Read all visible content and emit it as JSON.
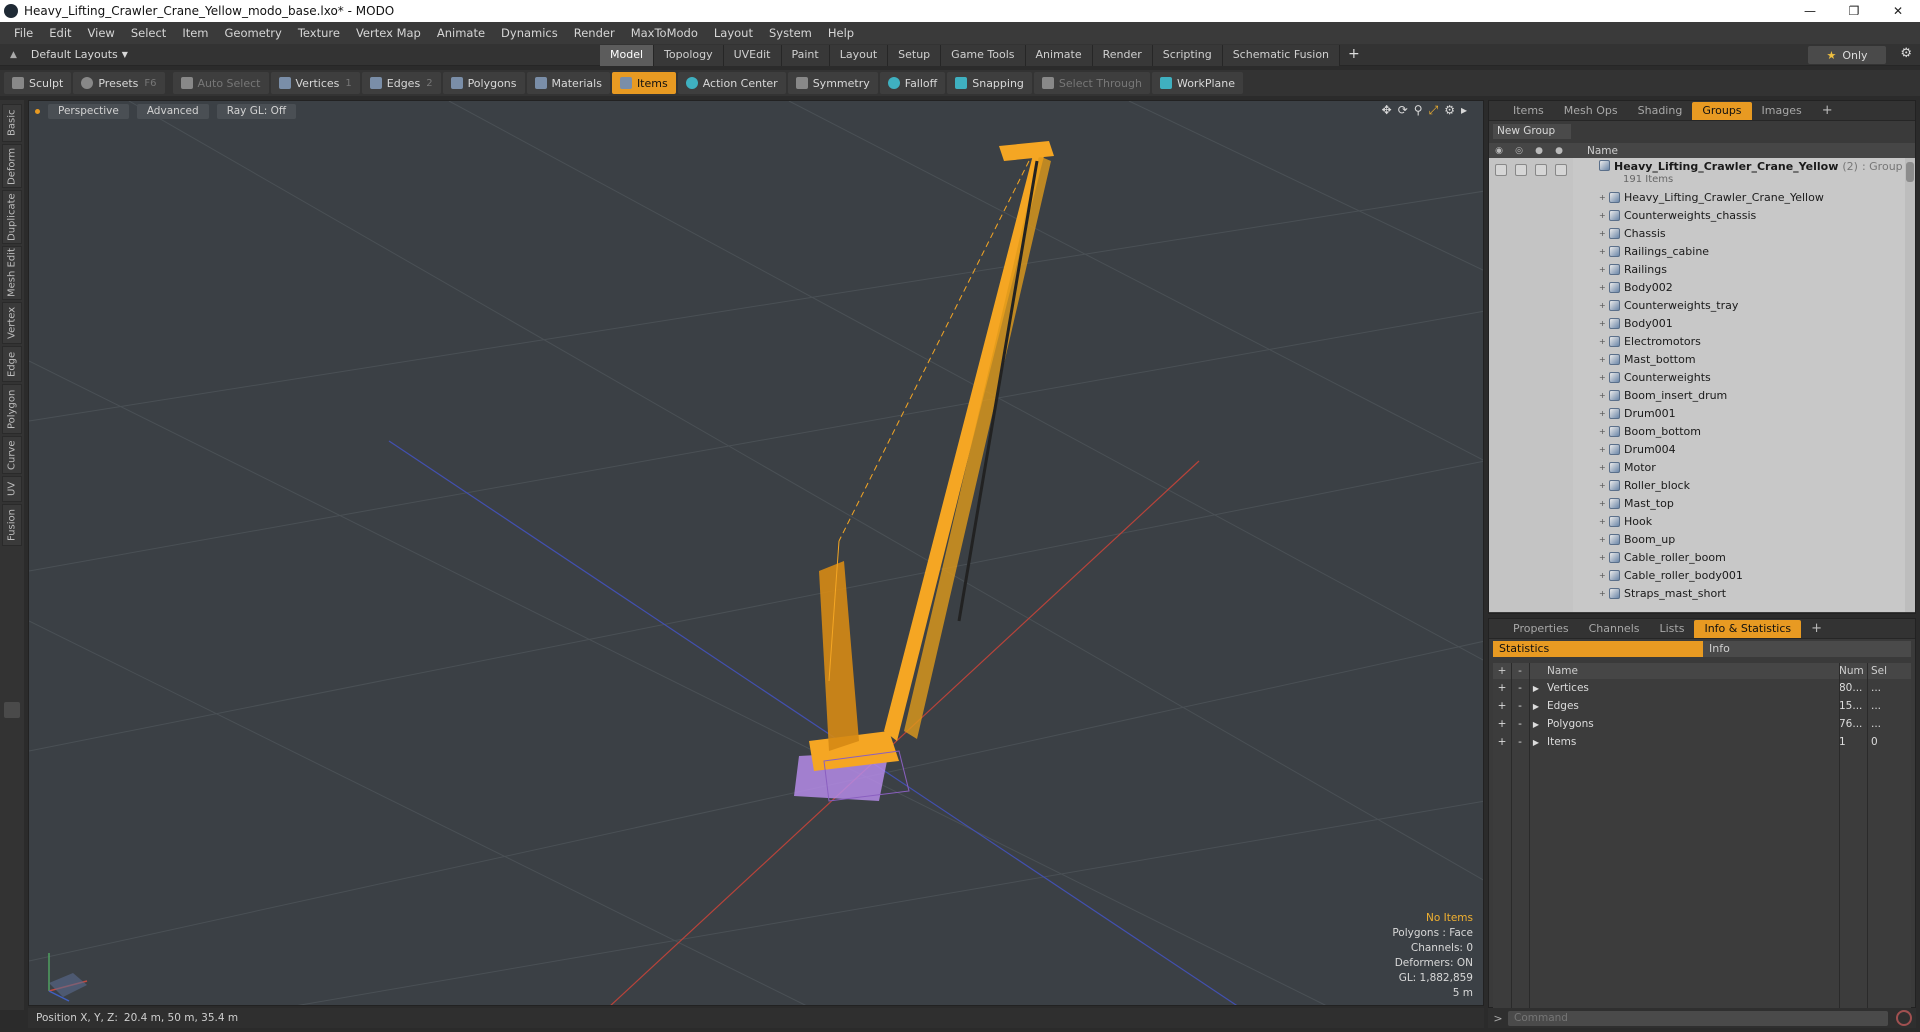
{
  "window": {
    "title": "Heavy_Lifting_Crawler_Crane_Yellow_modo_base.lxo* - MODO",
    "controls": [
      "minimize-icon",
      "restore-icon",
      "close-icon"
    ]
  },
  "menu": [
    "File",
    "Edit",
    "View",
    "Select",
    "Item",
    "Geometry",
    "Texture",
    "Vertex Map",
    "Animate",
    "Dynamics",
    "Render",
    "MaxToModo",
    "Layout",
    "System",
    "Help"
  ],
  "layout": {
    "dropdown_label": "Default Layouts",
    "tabs": [
      "Model",
      "Topology",
      "UVEdit",
      "Paint",
      "Layout",
      "Setup",
      "Game Tools",
      "Animate",
      "Render",
      "Scripting",
      "Schematic Fusion"
    ],
    "active_tab": "Model",
    "only_label": "Only"
  },
  "toolbar": {
    "sculpt": "Sculpt",
    "presets": "Presets",
    "presets_key": "F6",
    "auto_select": "Auto Select",
    "vertices": "Vertices",
    "vertices_key": "1",
    "edges": "Edges",
    "edges_key": "2",
    "polygons": "Polygons",
    "materials": "Materials",
    "items": "Items",
    "action_center": "Action Center",
    "symmetry": "Symmetry",
    "falloff": "Falloff",
    "snapping": "Snapping",
    "select_through": "Select Through",
    "workplane": "WorkPlane"
  },
  "left_tabs": [
    "Basic",
    "Deform",
    "Duplicate",
    "Mesh Edit",
    "Vertex",
    "Edge",
    "Polygon",
    "Curve",
    "UV",
    "Fusion"
  ],
  "viewport": {
    "view_mode": "Perspective",
    "shading": "Advanced",
    "raygl": "Ray GL: Off",
    "stats": {
      "selection": "No Items",
      "polygons": "Polygons : Face",
      "channels": "Channels: 0",
      "deformers": "Deformers: ON",
      "gl": "GL: 1,882,859",
      "scale": "5 m"
    },
    "colors": {
      "grid": "#4a5055",
      "x_axis": "#b8433a",
      "z_axis": "#4250b0",
      "crane": "#f5a623",
      "tracks": "#b58be8"
    }
  },
  "status": {
    "position_label": "Position X, Y, Z:",
    "position_value": "20.4 m, 50 m, 35.4 m"
  },
  "groups_panel": {
    "tabs": [
      "Items",
      "Mesh Ops",
      "Shading",
      "Groups",
      "Images"
    ],
    "active_tab": "Groups",
    "new_group": "New Group",
    "name_header": "Name",
    "group": {
      "name": "Heavy_Lifting_Crawler_Crane_Yellow",
      "count": "(2)",
      "kind": ": Group",
      "items": "191 Items"
    },
    "children": [
      "Heavy_Lifting_Crawler_Crane_Yellow",
      "Counterweights_chassis",
      "Chassis",
      "Railings_cabine",
      "Railings",
      "Body002",
      "Counterweights_tray",
      "Body001",
      "Electromotors",
      "Mast_bottom",
      "Counterweights",
      "Boom_insert_drum",
      "Drum001",
      "Boom_bottom",
      "Drum004",
      "Motor",
      "Roller_block",
      "Mast_top",
      "Hook",
      "Boom_up",
      "Cable_roller_boom",
      "Cable_roller_body001",
      "Straps_mast_short"
    ]
  },
  "info_panel": {
    "tabs": [
      "Properties",
      "Channels",
      "Lists",
      "Info & Statistics"
    ],
    "active_tab": "Info & Statistics",
    "subtabs": [
      "Statistics",
      "Info"
    ],
    "headers": {
      "name": "Name",
      "num": "Num",
      "sel": "Sel"
    },
    "rows": [
      {
        "name": "Vertices",
        "num": "80...",
        "sel": "..."
      },
      {
        "name": "Edges",
        "num": "15...",
        "sel": "..."
      },
      {
        "name": "Polygons",
        "num": "76...",
        "sel": "..."
      },
      {
        "name": "Items",
        "num": "1",
        "sel": "0"
      }
    ]
  },
  "command": {
    "placeholder": "Command"
  }
}
